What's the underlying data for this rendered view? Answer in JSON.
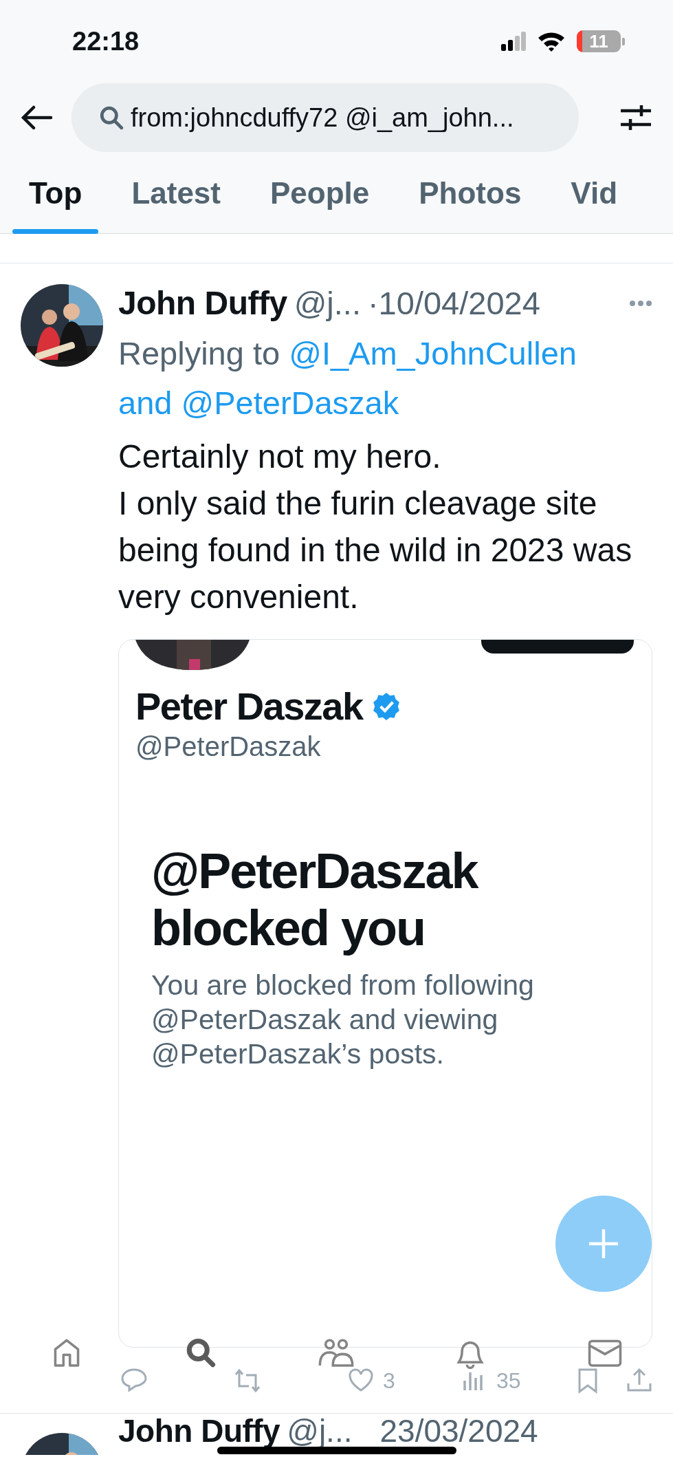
{
  "status_bar": {
    "time": "22:18",
    "battery": "11"
  },
  "search": {
    "value": "from:johncduffy72 @i_am_john..."
  },
  "tabs": [
    {
      "label": "Top",
      "selected": true
    },
    {
      "label": "Latest",
      "selected": false
    },
    {
      "label": "People",
      "selected": false
    },
    {
      "label": "Photos",
      "selected": false
    },
    {
      "label": "Vid",
      "selected": false
    }
  ],
  "tweet": {
    "author": "John Duffy",
    "handle": "@j...",
    "date": "·10/04/2024",
    "replying_prefix": "Replying to",
    "mentions": [
      "@I_Am_JohnCullen",
      "@PeterDaszak"
    ],
    "mention_joiner": "and",
    "text": "Certainly not my hero.\nI only said the furin cleavage site being found in the wild in 2023 was very convenient.",
    "embedded": {
      "name": "Peter Daszak",
      "verified": true,
      "handle": "@PeterDaszak",
      "heading": "@PeterDaszak blocked you",
      "message": "You are blocked from following @PeterDaszak and viewing @PeterDaszak’s posts."
    },
    "actions": [
      {
        "kind": "reply"
      },
      {
        "kind": "retweet"
      },
      {
        "kind": "like",
        "count": "3"
      },
      {
        "kind": "views",
        "count": "35"
      },
      {
        "kind": "bookmark"
      },
      {
        "kind": "share"
      }
    ]
  },
  "nav": [
    {
      "kind": "home",
      "selected": false
    },
    {
      "kind": "search",
      "selected": true
    },
    {
      "kind": "communities",
      "selected": false
    },
    {
      "kind": "notifications",
      "selected": false
    },
    {
      "kind": "messages",
      "selected": false
    }
  ],
  "next_tweet": {
    "author": "John Duffy",
    "handle": "@j...",
    "date": "23/03/2024"
  }
}
